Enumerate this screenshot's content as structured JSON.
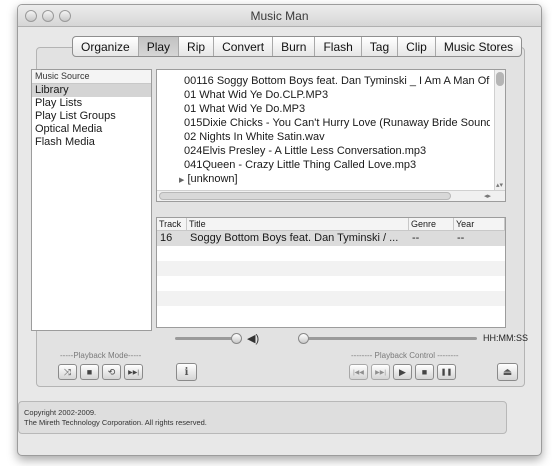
{
  "window": {
    "title": "Music Man"
  },
  "tabs": [
    {
      "label": "Organize"
    },
    {
      "label": "Play"
    },
    {
      "label": "Rip"
    },
    {
      "label": "Convert"
    },
    {
      "label": "Burn"
    },
    {
      "label": "Flash"
    },
    {
      "label": "Tag"
    },
    {
      "label": "Clip"
    },
    {
      "label": "Music Stores"
    }
  ],
  "active_tab": "Play",
  "source": {
    "header": "Music Source",
    "items": [
      {
        "label": "Library"
      },
      {
        "label": "Play Lists"
      },
      {
        "label": "Play List Groups"
      },
      {
        "label": "Optical Media"
      },
      {
        "label": "Flash Media"
      }
    ],
    "selected": "Library"
  },
  "files": {
    "rows": [
      "00116 Soggy Bottom Boys feat. Dan Tyminski _ I Am A Man Of...",
      "01 What Wid Ye Do.CLP.MP3",
      "01 What Wid Ye Do.MP3",
      "015Dixie Chicks - You Can't Hurry Love (Runaway Bride Sound...",
      "02 Nights In White Satin.wav",
      "024Elvis Presley - A Little Less Conversation.mp3",
      "041Queen - Crazy Little Thing Called Love.mp3"
    ],
    "folder": "[unknown]",
    "folder_arrow": "▶"
  },
  "tracks": {
    "headers": {
      "track": "Track",
      "title": "Title",
      "genre": "Genre",
      "year": "Year"
    },
    "rows": [
      {
        "track": "16",
        "title": "Soggy Bottom Boys feat. Dan Tyminski / ...",
        "genre": "--",
        "year": "--"
      }
    ]
  },
  "player": {
    "time": "HH:MM:SS",
    "volume_icon": "◀)"
  },
  "playback_mode": {
    "label": "-----Playback Mode-----"
  },
  "playback_control": {
    "label": "-------- Playback Control --------"
  },
  "footer": {
    "line1": "Copyright 2002-2009.",
    "line2": "The Mireth Technology Corporation. All rights reserved."
  },
  "icons": {
    "shuffle": "⤨",
    "stop_mode": "■",
    "repeat": "⟲",
    "next_mode": "▶▶|",
    "info": "i",
    "prev": "|◀◀",
    "next": "▶▶|",
    "play": "▶",
    "stop": "■",
    "pause": "❚❚",
    "eject": "⏏"
  }
}
